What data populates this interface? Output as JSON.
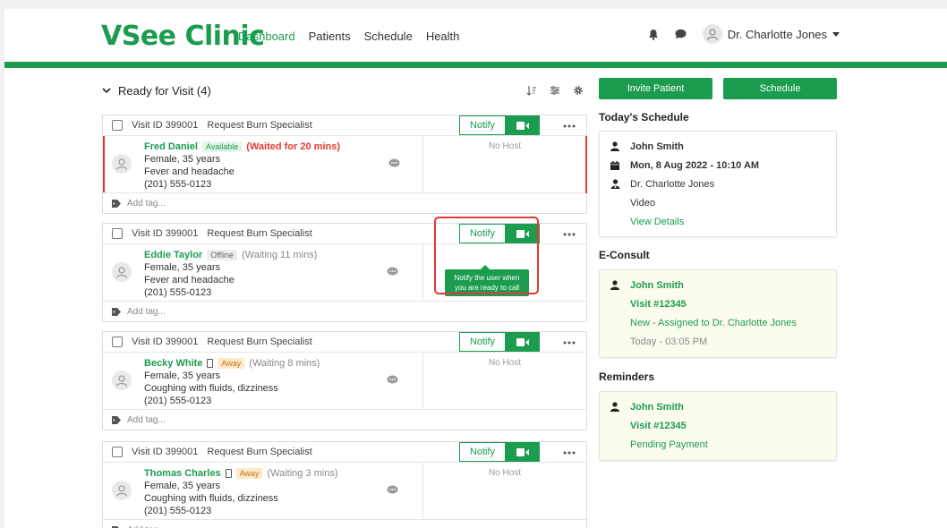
{
  "app": {
    "logo": "VSee Clinic",
    "nav": [
      "Dashboard",
      "Patients",
      "Schedule",
      "Health"
    ],
    "user_name": "Dr. Charlotte Jones"
  },
  "queue": {
    "title": "Ready for Visit (4)",
    "add_tag": "Add tag...",
    "notify_label": "Notify",
    "visits": [
      {
        "visit_id": "Visit ID 399001",
        "request": "Request Burn Specialist",
        "name": "Fred Daniel",
        "status": "Available",
        "wait": "(Waited for 20 mins)",
        "line1": "Female, 35 years",
        "line2": "Fever and headache",
        "line3": "(201) 555-0123",
        "host": "No Host"
      },
      {
        "visit_id": "Visit ID 399001",
        "request": "Request Burn Specialist",
        "name": "Eddie Taylor",
        "status": "Offline",
        "wait": "(Waiting 11 mins)",
        "line1": "Female, 35 years",
        "line2": "Fever and headache",
        "line3": "(201) 555-0123",
        "host": ""
      },
      {
        "visit_id": "Visit ID 399001",
        "request": "Request Burn Specialist",
        "name": "Becky White",
        "status": "Away",
        "wait": "(Waiting 8 mins)",
        "line1": "Female, 35 years",
        "line2": "Coughing with fluids, dizziness",
        "line3": "(201) 555-0123",
        "host": "No Host"
      },
      {
        "visit_id": "Visit ID 399001",
        "request": "Request Burn Specialist",
        "name": "Thomas Charles",
        "status": "Away",
        "wait": "(Waiting 3 mins)",
        "line1": "Female, 35 years",
        "line2": "Coughing with fluids, dizziness",
        "line3": "(201) 555-0123",
        "host": "No Host"
      }
    ],
    "tooltip": "Notify the user when you are ready to call"
  },
  "sidebar": {
    "invite_label": "Invite Patient",
    "schedule_label": "Schedule",
    "today_title": "Today's Schedule",
    "today": {
      "patient": "John Smith",
      "datetime": "Mon, 8 Aug 2022 - 10:10 AM",
      "doctor": "Dr. Charlotte Jones",
      "type": "Video",
      "link": "View Details"
    },
    "econsult_title": "E-Consult",
    "econsult": {
      "patient": "John Smith",
      "visit": "Visit #12345",
      "status": "New - Assigned to Dr. Charlotte Jones",
      "time": "Today - 03:05 PM"
    },
    "reminders_title": "Reminders",
    "reminder": {
      "patient": "John Smith",
      "visit": "Visit #12345",
      "status": "Pending Payment"
    }
  },
  "colors": {
    "brand": "#1b9c4f",
    "alert": "#e53935",
    "away": "#c07a12"
  }
}
